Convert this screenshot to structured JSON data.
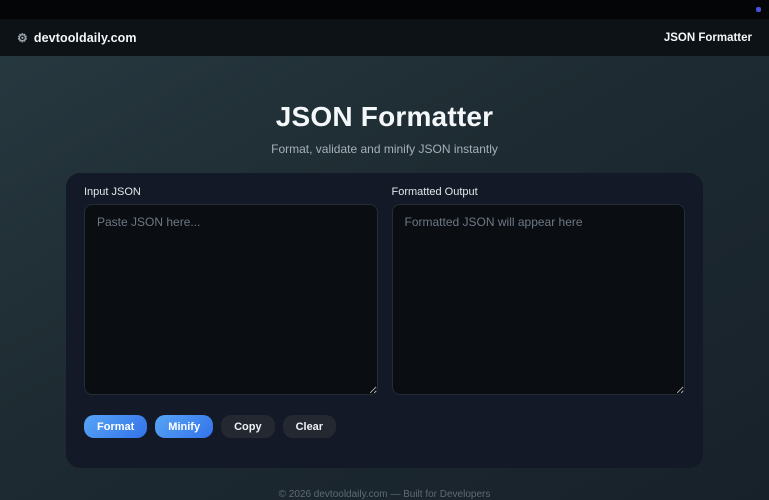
{
  "topbar": {
    "dot_color": "#4a52dd"
  },
  "nav": {
    "logo_icon": "⚙",
    "logo_text": "devtooldaily.com",
    "right_text": "JSON Formatter"
  },
  "hero": {
    "title": "JSON Formatter",
    "subtitle": "Format, validate and minify JSON instantly"
  },
  "editor": {
    "input": {
      "label": "Input JSON",
      "value": "",
      "placeholder": "Paste JSON here..."
    },
    "output": {
      "label": "Formatted Output",
      "value": "",
      "placeholder": "Formatted JSON will appear here"
    },
    "buttons": [
      {
        "label": "Format",
        "style": "primary"
      },
      {
        "label": "Minify",
        "style": "primary"
      },
      {
        "label": "Copy",
        "style": "secondary"
      },
      {
        "label": "Clear",
        "style": "secondary"
      }
    ]
  },
  "footer": {
    "text": "© 2026 devtooldaily.com — Built for Developers"
  },
  "colors": {
    "accent_gradient_start": "#57a5f6",
    "accent_gradient_end": "#3372e9",
    "card_bg": "#131926",
    "page_bg_top": "#283a41",
    "page_bg_bottom": "#17212a"
  }
}
